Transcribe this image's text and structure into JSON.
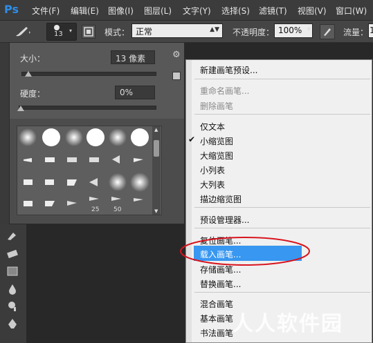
{
  "app": {
    "logo": "Ps"
  },
  "menubar": [
    "文件(F)",
    "编辑(E)",
    "图像(I)",
    "图层(L)",
    "文字(Y)",
    "选择(S)",
    "滤镜(T)",
    "视图(V)",
    "窗口(W)"
  ],
  "options": {
    "brush_size": "13",
    "mode_label": "模式：",
    "mode_value": "正常",
    "opacity_label": "不透明度：",
    "opacity_value": "100%",
    "flow_label": "流量：",
    "flow_value": "1"
  },
  "brush_panel": {
    "size_label": "大小：",
    "size_value": "13 像素",
    "size_level": 0.05,
    "hardness_label": "硬度：",
    "hardness_value": "0%",
    "hardness_level": 0.0,
    "thumb_labels": [
      "25",
      "50"
    ]
  },
  "context_menu": {
    "items": [
      {
        "label": "新建画笔预设...",
        "disabled": false
      },
      {
        "label": "重命名画笔...",
        "disabled": true
      },
      {
        "label": "删除画笔",
        "disabled": true
      },
      {
        "label": "仅文本",
        "disabled": false
      },
      {
        "label": "小缩览图",
        "disabled": false,
        "checked": true
      },
      {
        "label": "大缩览图",
        "disabled": false
      },
      {
        "label": "小列表",
        "disabled": false
      },
      {
        "label": "大列表",
        "disabled": false
      },
      {
        "label": "描边缩览图",
        "disabled": false
      },
      {
        "label": "预设管理器...",
        "disabled": false
      },
      {
        "label": "复位画笔...",
        "disabled": false
      },
      {
        "label": "载入画笔...",
        "disabled": false,
        "highlighted": true
      },
      {
        "label": "存储画笔...",
        "disabled": false
      },
      {
        "label": "替换画笔...",
        "disabled": false
      },
      {
        "label": "混合画笔",
        "disabled": false
      },
      {
        "label": "基本画笔",
        "disabled": false
      },
      {
        "label": "书法画笔",
        "disabled": false
      }
    ],
    "highlight_color": "#3897f0"
  },
  "annotation": {
    "ellipse_color": "#d8141e"
  },
  "watermark": "人人软件园"
}
